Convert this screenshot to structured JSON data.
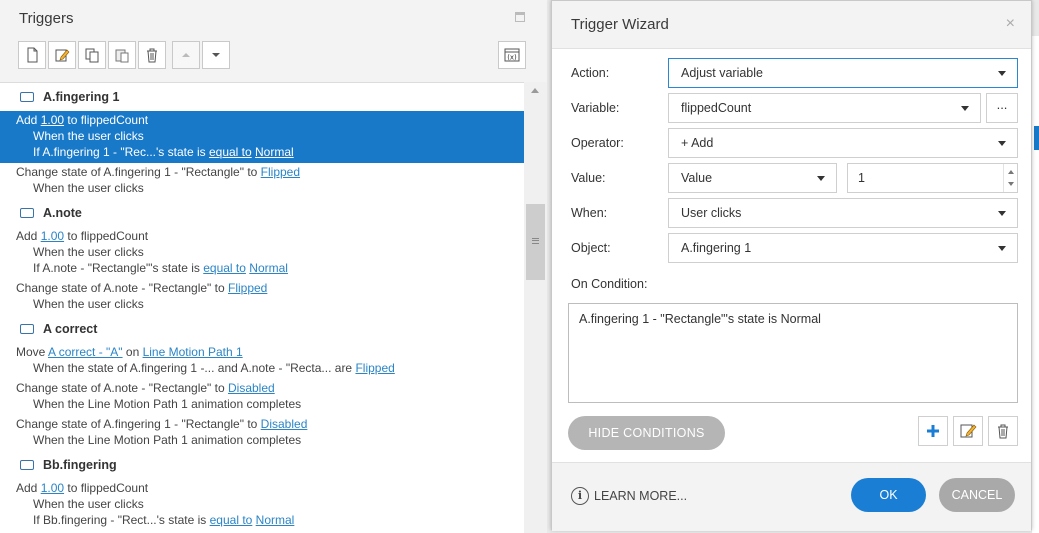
{
  "triggers_panel": {
    "title": "Triggers",
    "groups": [
      {
        "name": "A.fingering 1",
        "items": [
          {
            "pre": "Add ",
            "link1": "1.00",
            "mid": " to flippedCount",
            "line2": "When the user clicks",
            "line3_pre": "If A.fingering 1 - \"Rec...'s state is ",
            "line3_link1": "equal to",
            "line3_link2": "Normal"
          },
          {
            "pre": "Change state of A.fingering 1 - \"Rectangle\" to ",
            "link1": "Flipped",
            "line2": "When the user clicks"
          }
        ]
      },
      {
        "name": "A.note",
        "items": [
          {
            "pre": "Add ",
            "link1": "1.00",
            "mid": " to flippedCount",
            "line2": "When the user clicks",
            "line3_pre": "If A.note - \"Rectangle\"'s state is ",
            "line3_link1": "equal to",
            "line3_link2": "Normal"
          },
          {
            "pre": "Change state of A.note - \"Rectangle\" to ",
            "link1": "Flipped",
            "line2": "When the user clicks"
          }
        ]
      },
      {
        "name": "A correct",
        "items": [
          {
            "pre": "Move ",
            "link1": "A correct - \"A\"",
            "mid": " on ",
            "link2": "Line Motion Path 1",
            "line2_pre": "When the state of A.fingering 1 -... and A.note - \"Recta... are ",
            "line2_link": "Flipped"
          },
          {
            "pre": "Change state of A.note - \"Rectangle\" to ",
            "link1": "Disabled",
            "line2": "When the Line Motion Path 1 animation completes"
          },
          {
            "pre": "Change state of A.fingering 1 - \"Rectangle\" to ",
            "link1": "Disabled",
            "line2": "When the Line Motion Path 1 animation completes"
          }
        ]
      },
      {
        "name": "Bb.fingering",
        "items": [
          {
            "pre": "Add ",
            "link1": "1.00",
            "mid": " to flippedCount",
            "line2": "When the user clicks",
            "line3_pre": "If Bb.fingering - \"Rect...'s state is ",
            "line3_link1": "equal to",
            "line3_link2": "Normal"
          }
        ]
      }
    ]
  },
  "wizard": {
    "title": "Trigger Wizard",
    "close": "×",
    "action_label": "Action:",
    "action_value": "Adjust variable",
    "variable_label": "Variable:",
    "variable_value": "flippedCount",
    "variable_more": "...",
    "operator_label": "Operator:",
    "operator_value": "+ Add",
    "value_label": "Value:",
    "value_type": "Value",
    "value_number": "1",
    "when_label": "When:",
    "when_value": "User clicks",
    "object_label": "Object:",
    "object_value": "A.fingering 1",
    "condition_label": "On Condition:",
    "condition_text": "A.fingering 1 - \"Rectangle\"'s state is Normal",
    "hide_conditions": "HIDE CONDITIONS",
    "learn_more": "LEARN MORE...",
    "ok": "OK",
    "cancel": "CANCEL"
  },
  "colors": {
    "selected_row": "#1879c9",
    "link": "#2a85c7",
    "ok_button": "#1a7fd4",
    "cancel_button": "#a9a9a9"
  }
}
